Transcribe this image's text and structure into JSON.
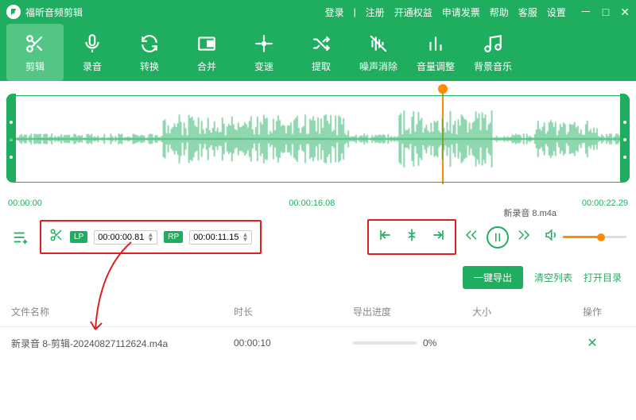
{
  "titlebar": {
    "app_title": "福昕音频剪辑",
    "nav": {
      "login": "登录",
      "register": "注册",
      "vip": "开通权益",
      "invoice": "申请发票",
      "help": "帮助",
      "support": "客服",
      "settings": "设置"
    }
  },
  "toolbar": {
    "items": [
      {
        "id": "cut",
        "label": "剪辑",
        "active": true
      },
      {
        "id": "record",
        "label": "录音"
      },
      {
        "id": "convert",
        "label": "转换"
      },
      {
        "id": "merge",
        "label": "合并"
      },
      {
        "id": "speed",
        "label": "变速"
      },
      {
        "id": "extract",
        "label": "提取"
      },
      {
        "id": "denoise",
        "label": "噪声消除"
      },
      {
        "id": "volume",
        "label": "音量调整"
      },
      {
        "id": "bgm",
        "label": "背景音乐"
      }
    ]
  },
  "timeline": {
    "start": "00:00:00",
    "mid": "00:00:16.08",
    "end": "00:00:22.29"
  },
  "cut": {
    "lp_label": "LP",
    "lp_value": "00:00:00.81",
    "rp_label": "RP",
    "rp_value": "00:00:11.15"
  },
  "player": {
    "track_name": "新录音 8.m4a"
  },
  "actions": {
    "export": "一键导出",
    "clear": "清空列表",
    "open_dir": "打开目录"
  },
  "table": {
    "headers": {
      "name": "文件名称",
      "duration": "时长",
      "progress": "导出进度",
      "size": "大小",
      "op": "操作"
    },
    "rows": [
      {
        "name": "新录音 8-剪辑-20240827112624.m4a",
        "duration": "00:00:10",
        "progress": "0%",
        "size": ""
      }
    ]
  }
}
